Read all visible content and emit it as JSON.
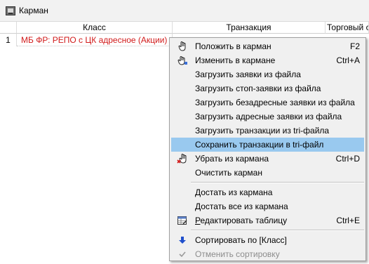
{
  "window": {
    "title": "Карман"
  },
  "table": {
    "columns": [
      "Класс",
      "Транзакция",
      "Торговый с"
    ],
    "rows": [
      {
        "num": "1",
        "class": "МБ ФР: РЕПО с ЦК адресное (Акции)"
      }
    ]
  },
  "menu": {
    "items": [
      {
        "label": "Положить в карман",
        "shortcut": "F2",
        "icon": "hand-put-icon"
      },
      {
        "label": "Изменить в кармане",
        "shortcut": "Ctrl+A",
        "icon": "hand-edit-icon"
      },
      {
        "label": "Загрузить заявки из файла",
        "shortcut": ""
      },
      {
        "label": "Загрузить стоп-заявки из файла",
        "shortcut": ""
      },
      {
        "label": "Загрузить безадресные заявки из файла",
        "shortcut": ""
      },
      {
        "label": "Загрузить адресные заявки из файла",
        "shortcut": ""
      },
      {
        "label": "Загрузить транзакции из tri-файла",
        "shortcut": ""
      },
      {
        "label": "Сохранить транзакции в tri-файл",
        "shortcut": "",
        "highlighted": true
      },
      {
        "label": "Убрать из кармана",
        "shortcut": "Ctrl+D",
        "icon": "hand-remove-icon"
      },
      {
        "label": "Очистить карман",
        "shortcut": ""
      },
      {
        "label": "Достать из кармана",
        "shortcut": ""
      },
      {
        "label": "Достать все из кармана",
        "shortcut": ""
      },
      {
        "label": "Редактировать таблицу",
        "shortcut": "Ctrl+E",
        "icon": "edit-table-icon"
      },
      {
        "label": "Сортировать по [Класс]",
        "shortcut": "",
        "icon": "sort-down-arrow-icon"
      },
      {
        "label": "Отменить сортировку",
        "shortcut": "",
        "icon": "check-icon",
        "disabled": true
      }
    ]
  },
  "colors": {
    "highlight": "#99c9ef",
    "row_text": "#d11a1a",
    "disabled_text": "#8d8d8d",
    "menu_bg": "#f0f0f0"
  }
}
